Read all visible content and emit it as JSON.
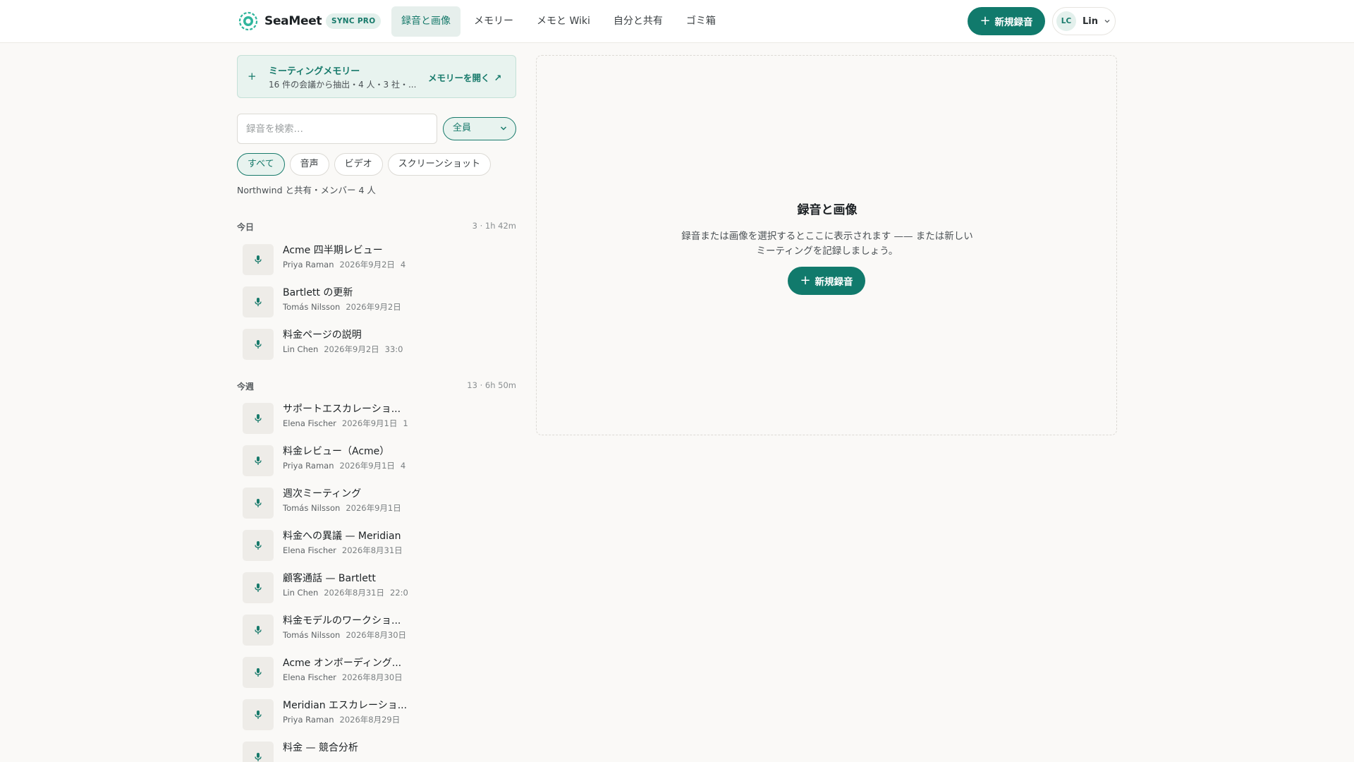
{
  "brand": {
    "name": "SeaMeet",
    "plan_badge": "SYNC PRO"
  },
  "nav": [
    {
      "label": "録音と画像",
      "active": true
    },
    {
      "label": "メモリー",
      "active": false
    },
    {
      "label": "メモと Wiki",
      "active": false
    },
    {
      "label": "自分と共有",
      "active": false
    },
    {
      "label": "ゴミ箱",
      "active": false
    }
  ],
  "header": {
    "new_recording_label": "新規録音"
  },
  "user": {
    "initials": "LC",
    "name": "Lin"
  },
  "memory": {
    "title": "ミーティングメモリー",
    "subtitle": "16 件の会議から抽出・4 人・3 社・...",
    "open_label": "メモリーを開く"
  },
  "search": {
    "placeholder": "録音を検索…",
    "value": ""
  },
  "filter_select": {
    "value": "全員"
  },
  "chips": [
    {
      "label": "すべて",
      "active": true
    },
    {
      "label": "音声",
      "active": false
    },
    {
      "label": "ビデオ",
      "active": false
    },
    {
      "label": "スクリーンショット",
      "active": false
    }
  ],
  "shared_note": "Northwind と共有・メンバー 4 人",
  "groups": {
    "today": {
      "label": "今日",
      "meta": "3 · 1h 42m",
      "items": [
        {
          "title": "Acme 四半期レビュー",
          "person": "Priya Raman",
          "date": "2026年9月2日",
          "extra": "4"
        },
        {
          "title": "Bartlett の更新",
          "person": "Tomás Nilsson",
          "date": "2026年9月2日",
          "extra": ""
        },
        {
          "title": "料金ページの説明",
          "person": "Lin Chen",
          "date": "2026年9月2日",
          "extra": "33:0"
        }
      ]
    },
    "week": {
      "label": "今週",
      "meta": "13 · 6h 50m",
      "items": [
        {
          "title": "サポートエスカレーショ...",
          "person": "Elena Fischer",
          "date": "2026年9月1日",
          "extra": "1"
        },
        {
          "title": "料金レビュー（Acme）",
          "person": "Priya Raman",
          "date": "2026年9月1日",
          "extra": "4"
        },
        {
          "title": "週次ミーティング",
          "person": "Tomás Nilsson",
          "date": "2026年9月1日",
          "extra": ""
        },
        {
          "title": "料金への異議 — Meridian",
          "person": "Elena Fischer",
          "date": "2026年8月31日",
          "extra": ""
        },
        {
          "title": "顧客通話 — Bartlett",
          "person": "Lin Chen",
          "date": "2026年8月31日",
          "extra": "22:0"
        },
        {
          "title": "料金モデルのワークショ...",
          "person": "Tomás Nilsson",
          "date": "2026年8月30日",
          "extra": ""
        },
        {
          "title": "Acme オンボーディング...",
          "person": "Elena Fischer",
          "date": "2026年8月30日",
          "extra": ""
        },
        {
          "title": "Meridian エスカレーショ...",
          "person": "Priya Raman",
          "date": "2026年8月29日",
          "extra": ""
        },
        {
          "title": "料金 — 競合分析",
          "person": "",
          "date": "",
          "extra": ""
        }
      ]
    }
  },
  "panel": {
    "title": "録音と画像",
    "description": "録音または画像を選択するとここに表示されます —— または新しいミーティングを記録しましょう。",
    "button_label": "新規録音"
  },
  "colors": {
    "accent": "#117a6c",
    "accent_light": "#e8f3ef",
    "background": "#faf9f7"
  }
}
